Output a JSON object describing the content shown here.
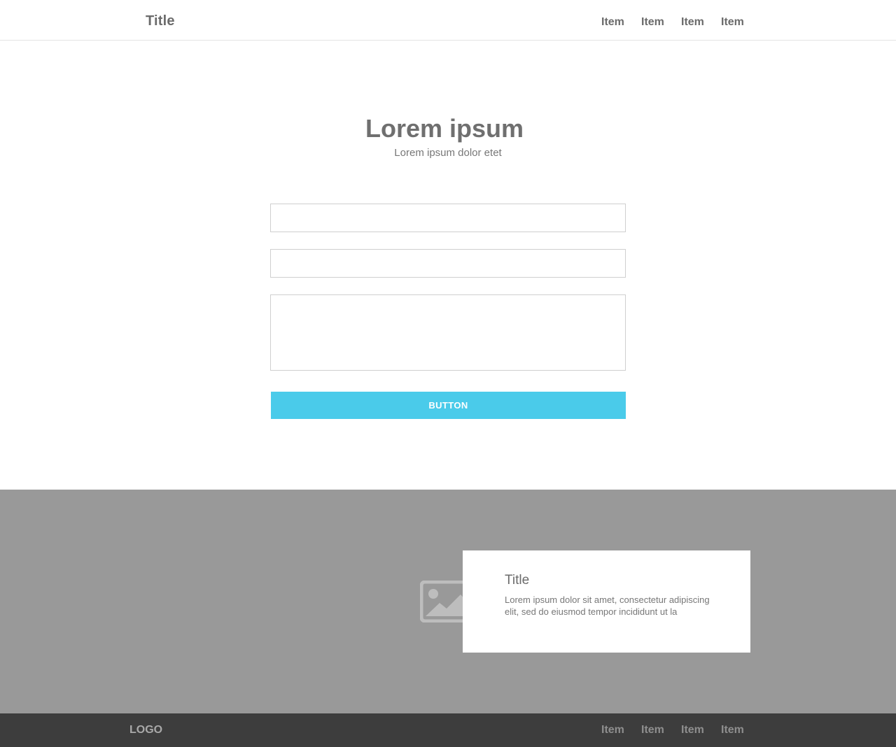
{
  "header": {
    "title": "Title",
    "nav": [
      "Item",
      "Item",
      "Item",
      "Item"
    ]
  },
  "hero": {
    "title": "Lorem ipsum",
    "subtitle": "Lorem ipsum dolor etet"
  },
  "form": {
    "field_1_value": "",
    "field_2_value": "",
    "message_value": "",
    "button_label": "BUTTON"
  },
  "feature": {
    "image_icon": "image-icon",
    "card_title": "Title",
    "card_text": "Lorem ipsum dolor sit amet, consectetur adipiscing elit, sed do eiusmod tempor incididunt ut la"
  },
  "footer": {
    "logo": "LOGO",
    "nav": [
      "Item",
      "Item",
      "Item",
      "Item"
    ]
  },
  "colors": {
    "accent": "#4acbea",
    "band": "#999999",
    "footer": "#3d3d3d",
    "text": "#6b6b6b"
  }
}
